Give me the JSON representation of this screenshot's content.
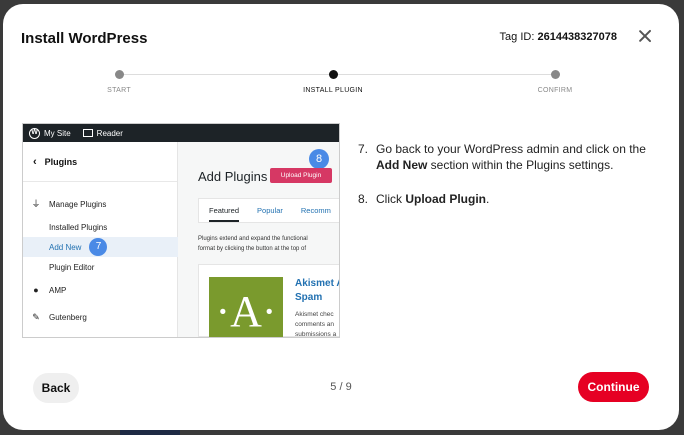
{
  "modal": {
    "title": "Install WordPress",
    "tag_label": "Tag ID:",
    "tag_value": "2614438327078"
  },
  "stepper": {
    "steps": [
      {
        "label": "START",
        "state": "done"
      },
      {
        "label": "INSTALL PLUGIN",
        "state": "active"
      },
      {
        "label": "CONFIRM",
        "state": "pending"
      }
    ]
  },
  "screenshot": {
    "topbar": {
      "site_label": "My Site",
      "reader_label": "Reader"
    },
    "sidebar": {
      "back_label": "Plugins",
      "items": [
        {
          "label": "Manage Plugins",
          "icon": "plug-icon"
        },
        {
          "label": "Installed Plugins"
        },
        {
          "label": "Add New",
          "badge": "7"
        },
        {
          "label": "Plugin Editor"
        },
        {
          "label": "AMP",
          "icon": "amp-icon"
        },
        {
          "label": "Gutenberg",
          "icon": "pencil-icon"
        }
      ]
    },
    "main": {
      "title": "Add Plugins",
      "upload_button": "Upload Plugin",
      "badge": "8",
      "tabs": [
        "Featured",
        "Popular",
        "Recomm"
      ],
      "description_line1": "Plugins extend and expand the functional",
      "description_line2": "format by clicking the button at the top of",
      "card": {
        "logo_letter": "A",
        "title_line1": "Akismet A",
        "title_line2": "Spam",
        "desc_line1": "Akismet chec",
        "desc_line2": "comments an",
        "desc_line3": "submissions a"
      }
    }
  },
  "instructions": [
    {
      "num": "7.",
      "pre": "Go back to your WordPress admin and click on the ",
      "bold": "Add New",
      "post": " section within the Plugins settings."
    },
    {
      "num": "8.",
      "pre": "Click ",
      "bold": "Upload Plugin",
      "post": "."
    }
  ],
  "footer": {
    "back_label": "Back",
    "page_indicator": "5 / 9",
    "continue_label": "Continue"
  },
  "colors": {
    "accent": "#e60023",
    "badge": "#4a8ae6",
    "upload_button": "#d63864",
    "wp_bar": "#1d2327",
    "akismet_green": "#7a9a2d"
  }
}
